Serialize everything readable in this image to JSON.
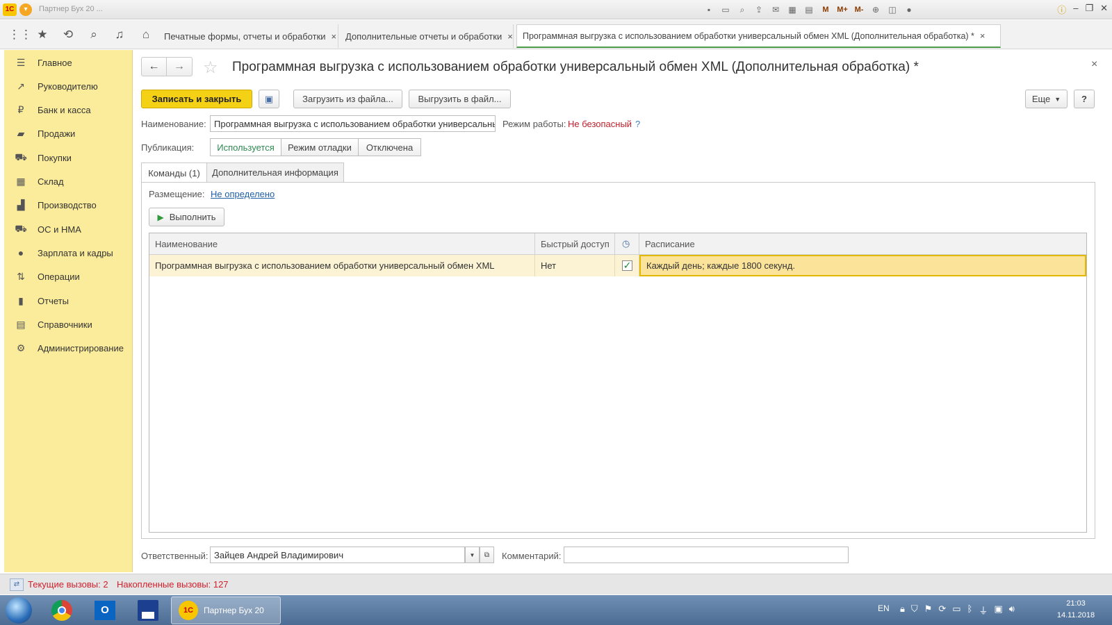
{
  "window": {
    "app_logo": "1С",
    "title_masked": "Партнер Бух 20 ...",
    "memory_buttons": [
      "M",
      "M+",
      "M-"
    ]
  },
  "tabs": [
    {
      "label": "Печатные формы, отчеты и обработки",
      "close": "×"
    },
    {
      "label": "Дополнительные отчеты и обработки",
      "close": "×"
    },
    {
      "label": "Программная выгрузка с использованием обработки универсальный обмен XML (Дополнительная обработка) *",
      "close": "×"
    }
  ],
  "sidebar": {
    "items": [
      {
        "label": "Главное",
        "icon": "menu-icon"
      },
      {
        "label": "Руководителю",
        "icon": "trend-icon"
      },
      {
        "label": "Банк и касса",
        "icon": "ruble-icon"
      },
      {
        "label": "Продажи",
        "icon": "bag-icon"
      },
      {
        "label": "Покупки",
        "icon": "cart-icon"
      },
      {
        "label": "Склад",
        "icon": "warehouse-icon"
      },
      {
        "label": "Производство",
        "icon": "factory-icon"
      },
      {
        "label": "ОС и НМА",
        "icon": "truck-icon"
      },
      {
        "label": "Зарплата и кадры",
        "icon": "person-icon"
      },
      {
        "label": "Операции",
        "icon": "operations-icon"
      },
      {
        "label": "Отчеты",
        "icon": "bar-chart-icon"
      },
      {
        "label": "Справочники",
        "icon": "book-icon"
      },
      {
        "label": "Администрирование",
        "icon": "gear-icon"
      }
    ]
  },
  "form": {
    "title": "Программная выгрузка с использованием обработки универсальный обмен XML (Дополнительная обработка) *",
    "close": "×",
    "toolbar": {
      "save_close": "Записать и закрыть",
      "load_from_file": "Загрузить из файла...",
      "save_to_file": "Выгрузить в файл...",
      "more": "Еще",
      "help": "?"
    },
    "name_label": "Наименование:",
    "name_value": "Программная выгрузка с использованием обработки универсальный",
    "mode_label": "Режим работы:",
    "mode_value": "Не безопасный",
    "mode_help": "?",
    "publication_label": "Публикация:",
    "publication_options": [
      "Используется",
      "Режим отладки",
      "Отключена"
    ],
    "publication_selected": "Используется",
    "inner_tabs": [
      "Команды (1)",
      "Дополнительная информация"
    ],
    "placement_label": "Размещение:",
    "placement_value": "Не определено",
    "run_button": "Выполнить",
    "table": {
      "columns": [
        "Наименование",
        "Быстрый доступ",
        "",
        "Расписание"
      ],
      "rows": [
        {
          "name": "Программная выгрузка с использованием обработки универсальный обмен XML",
          "quick_access": "Нет",
          "scheduled": true,
          "schedule": "Каждый день; каждые 1800 секунд."
        }
      ]
    },
    "responsible_label": "Ответственный:",
    "responsible_value": "Зайцев Андрей Владимирович",
    "comment_label": "Комментарий:",
    "comment_value": ""
  },
  "statusbar": {
    "current_calls": "Текущие вызовы: 2",
    "accumulated_calls": "Накопленные вызовы: 127"
  },
  "taskbar": {
    "active_app": "Партнер Бух 20",
    "lang": "EN",
    "time": "21:03",
    "date": "14.11.2018"
  },
  "colors": {
    "sidebar_bg": "#fbec9c",
    "primary_button": "#f5d116",
    "warning_text": "#d0202b",
    "active_tab_accent": "#4b9b4b"
  }
}
